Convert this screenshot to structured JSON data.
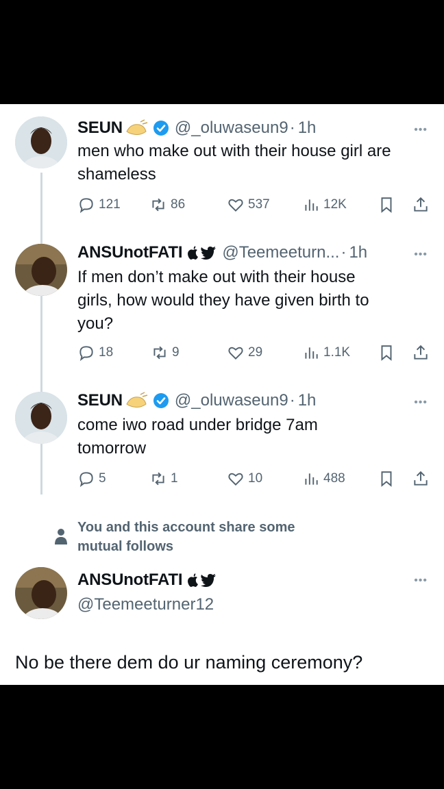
{
  "tweets": [
    {
      "name": "SEUN",
      "handle": "@_oluwaseun9",
      "sep": "·",
      "time": "1h",
      "text_line1": "men who make out with their house girl are",
      "text_line2": "shameless",
      "replies": "121",
      "reposts": "86",
      "likes": "537",
      "views": "12K"
    },
    {
      "name": "ANSUnotFATI",
      "handle": "@Teemeeturn...",
      "sep": "·",
      "time": "1h",
      "text_line1": "If men don’t make out with their house",
      "text_line2": "girls, how would they have given birth to",
      "text_line3": "you?",
      "replies": "18",
      "reposts": "9",
      "likes": "29",
      "views": "1.1K"
    },
    {
      "name": "SEUN",
      "handle": "@_oluwaseun9",
      "sep": "·",
      "time": "1h",
      "text_line1": "come iwo road under bridge 7am",
      "text_line2": "tomorrow",
      "replies": "5",
      "reposts": "1",
      "likes": "10",
      "views": "488"
    }
  ],
  "mutual_notice": {
    "line1": "You and this account share some",
    "line2": "mutual follows"
  },
  "reply_target": {
    "name": "ANSUnotFATI",
    "handle": "@Teemeeturner12"
  },
  "reply_draft": "No be there dem do ur naming ceremony?",
  "more_glyph": "•••",
  "colors": {
    "verified": "#1d9bf0",
    "muted": "#536471",
    "thread_line": "#cfd9de"
  }
}
